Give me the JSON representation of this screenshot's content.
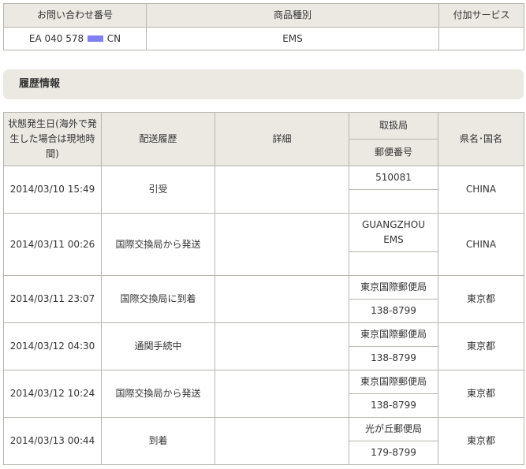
{
  "summary": {
    "headers": [
      "お問い合わせ番号",
      "商品種別",
      "付加サービス"
    ],
    "tracking_prefix": "EA 040 578",
    "tracking_suffix": "CN",
    "product_type": "EMS",
    "additional_service": ""
  },
  "history_section": {
    "title": "履歴情報"
  },
  "history_table": {
    "headers": {
      "datetime": "状態発生日(海外で発生した場合は現地時間)",
      "status": "配送履歴",
      "detail": "詳細",
      "office": "取扱局",
      "postal": "郵便番号",
      "region": "県名･国名"
    },
    "rows": [
      {
        "datetime": "2014/03/10 15:49",
        "status": "引受",
        "detail": "",
        "office": "510081",
        "postal": "",
        "region": "CHINA"
      },
      {
        "datetime": "2014/03/11 00:26",
        "status": "国際交換局から発送",
        "detail": "",
        "office": "GUANGZHOU EMS",
        "postal": "",
        "region": "CHINA"
      },
      {
        "datetime": "2014/03/11 23:07",
        "status": "国際交換局に到着",
        "detail": "",
        "office": "東京国際郵便局",
        "postal": "138-8799",
        "region": "東京都"
      },
      {
        "datetime": "2014/03/12 04:30",
        "status": "通関手続中",
        "detail": "",
        "office": "東京国際郵便局",
        "postal": "138-8799",
        "region": "東京都"
      },
      {
        "datetime": "2014/03/12 10:24",
        "status": "国際交換局から発送",
        "detail": "",
        "office": "東京国際郵便局",
        "postal": "138-8799",
        "region": "東京都"
      },
      {
        "datetime": "2014/03/13 00:44",
        "status": "到着",
        "detail": "",
        "office": "光が丘郵便局",
        "postal": "179-8799",
        "region": "東京都"
      }
    ]
  },
  "colors": {
    "header_bg": "#ece8e2",
    "border": "#b8b4ad",
    "redaction": "#8080f0"
  }
}
